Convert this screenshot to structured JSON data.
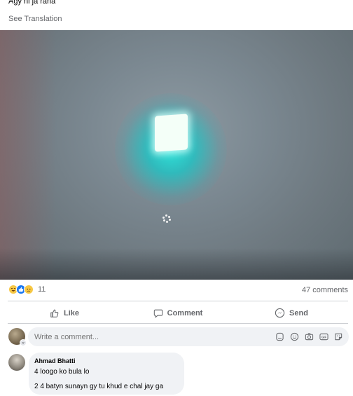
{
  "post": {
    "text": "Agy ni ja raha",
    "see_translation": "See Translation"
  },
  "photo": {
    "description_icon": "photo-image"
  },
  "stats": {
    "reaction_icons": [
      "haha-reaction-icon",
      "like-reaction-icon",
      "sad-reaction-icon"
    ],
    "reaction_count": "11",
    "comments_count": "47 comments"
  },
  "actions": {
    "like": "Like",
    "comment": "Comment",
    "send": "Send"
  },
  "composer": {
    "placeholder": "Write a comment...",
    "tool_icons": [
      "avatar-sticker-icon",
      "emoji-icon",
      "camera-icon",
      "gif-icon",
      "sticker-icon"
    ]
  },
  "comments": [
    {
      "author": "Ahmad Bhatti",
      "lines": [
        "4 loogo ko bula lo",
        "2 4 batyn sunayn gy tu khud e chal jay ga"
      ]
    }
  ],
  "colors": {
    "secondary_text": "#65676b",
    "input_bg": "#f0f2f5",
    "like_blue": "#1877f2",
    "glow_cyan": "#28e6dc"
  }
}
